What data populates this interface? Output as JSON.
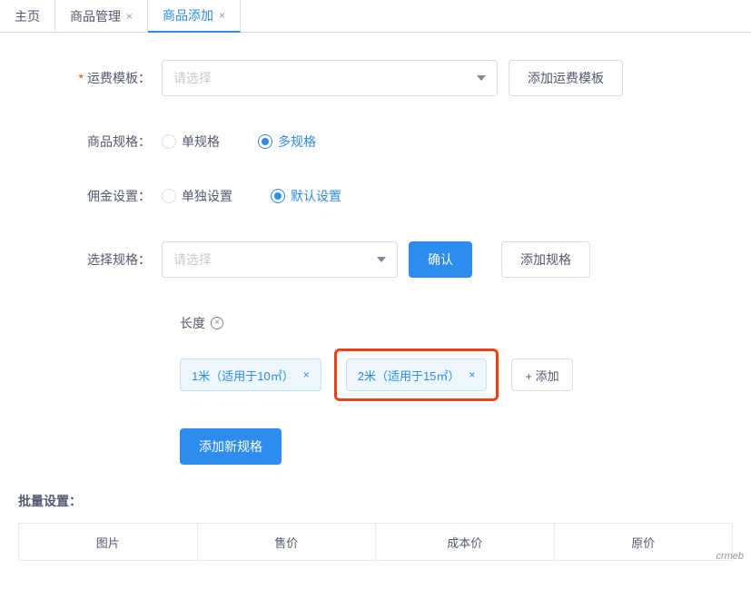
{
  "tabs": [
    {
      "label": "主页",
      "closable": false,
      "active": false
    },
    {
      "label": "商品管理",
      "closable": true,
      "active": false
    },
    {
      "label": "商品添加",
      "closable": true,
      "active": true
    }
  ],
  "form": {
    "shipping": {
      "label": "运费模板：",
      "placeholder": "请选择",
      "add_btn": "添加运费模板"
    },
    "spec": {
      "label": "商品规格：",
      "opt1": "单规格",
      "opt2": "多规格"
    },
    "commission": {
      "label": "佣金设置：",
      "opt1": "单独设置",
      "opt2": "默认设置"
    },
    "select_spec": {
      "label": "选择规格：",
      "placeholder": "请选择",
      "confirm": "确认",
      "add_btn": "添加规格"
    }
  },
  "spec_group": {
    "title": "长度",
    "tags": [
      "1米（适用于10㎡）",
      "2米（适用于15㎡）"
    ],
    "add_label": "+ 添加"
  },
  "add_new_spec": "添加新规格",
  "batch_label": "批量设置：",
  "table_headers": [
    "图片",
    "售价",
    "成本价",
    "原价"
  ],
  "watermark": "crmeb"
}
